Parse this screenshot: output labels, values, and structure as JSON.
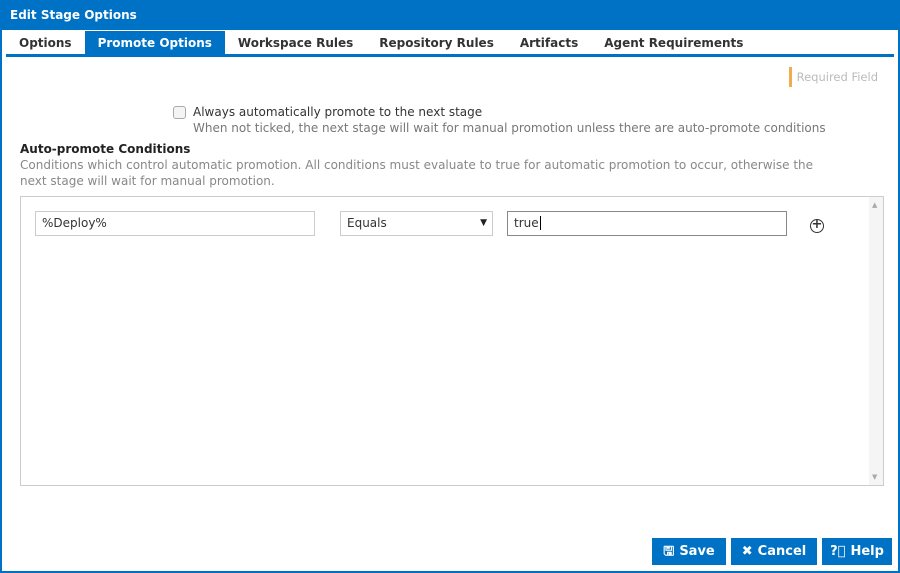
{
  "window": {
    "title": "Edit Stage Options"
  },
  "tabs": [
    {
      "label": "Options"
    },
    {
      "label": "Promote Options",
      "active": true
    },
    {
      "label": "Workspace Rules"
    },
    {
      "label": "Repository Rules"
    },
    {
      "label": "Artifacts"
    },
    {
      "label": "Agent Requirements"
    }
  ],
  "required_label": "Required Field",
  "always_promote": {
    "label": "Always automatically promote to the next stage",
    "help": "When not ticked, the next stage will wait for manual promotion unless there are auto-promote conditions",
    "checked": false
  },
  "conditions": {
    "title": "Auto-promote Conditions",
    "description": "Conditions which control automatic promotion. All conditions must evaluate to true for automatic promotion to occur, otherwise the next stage will wait for manual promotion.",
    "rows": [
      {
        "variable": "%Deploy%",
        "operator": "Equals",
        "value": "true"
      }
    ]
  },
  "buttons": {
    "save": "Save",
    "cancel": "Cancel",
    "help": "Help"
  },
  "colors": {
    "accent": "#0072c6",
    "required": "#f0ad4e"
  }
}
